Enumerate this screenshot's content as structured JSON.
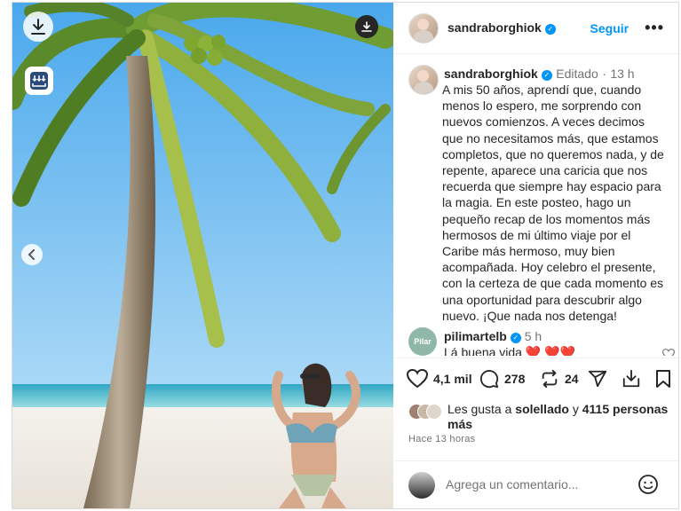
{
  "post": {
    "username": "sandraborghiok",
    "follow_label": "Seguir",
    "more_label": "•••",
    "edited_label": "Editado",
    "separator": "·",
    "age": "13 h",
    "caption": "A mis 50 años, aprendí que, cuando menos lo espero, me sorprendo con nuevos comienzos. A veces decimos que no necesitamos más, que estamos completos, que no queremos nada, y de repente, aparece una caricia que nos recuerda que siempre hay espacio para la magia. En este posteo, hago un pequeño recap de los momentos más hermosos de mi último viaje por el Caribe más hermoso, muy bien acompañada. Hoy celebro el presente, con la certeza de que cada momento es una oportunidad para descubrir algo nuevo. ¡Que nada nos detenga!"
  },
  "comment": {
    "avatar_text": "Pilar",
    "username": "pilimartelb",
    "age": "5 h",
    "text": "Lá buena vida ❤️ ❤️❤️"
  },
  "actions": {
    "likes_count": "4,1 mil",
    "comments_count": "278",
    "reposts_count": "24"
  },
  "likes": {
    "prefix": "Les gusta a ",
    "first_user": "solellado",
    "connector": " y ",
    "others": "4115 personas más"
  },
  "timestamp": "Hace 13 horas",
  "add_comment": {
    "placeholder": "Agrega un comentario..."
  },
  "icons": [
    "download-icon",
    "download-tray-icon",
    "download-dark-icon",
    "chevron-left-icon",
    "verified-icon",
    "heart-icon",
    "comment-icon",
    "repost-icon",
    "share-icon",
    "save-download-icon",
    "bookmark-icon",
    "emoji-icon"
  ],
  "colors": {
    "accent": "#0095f6",
    "muted": "#737373",
    "heart": "#e0245e"
  }
}
